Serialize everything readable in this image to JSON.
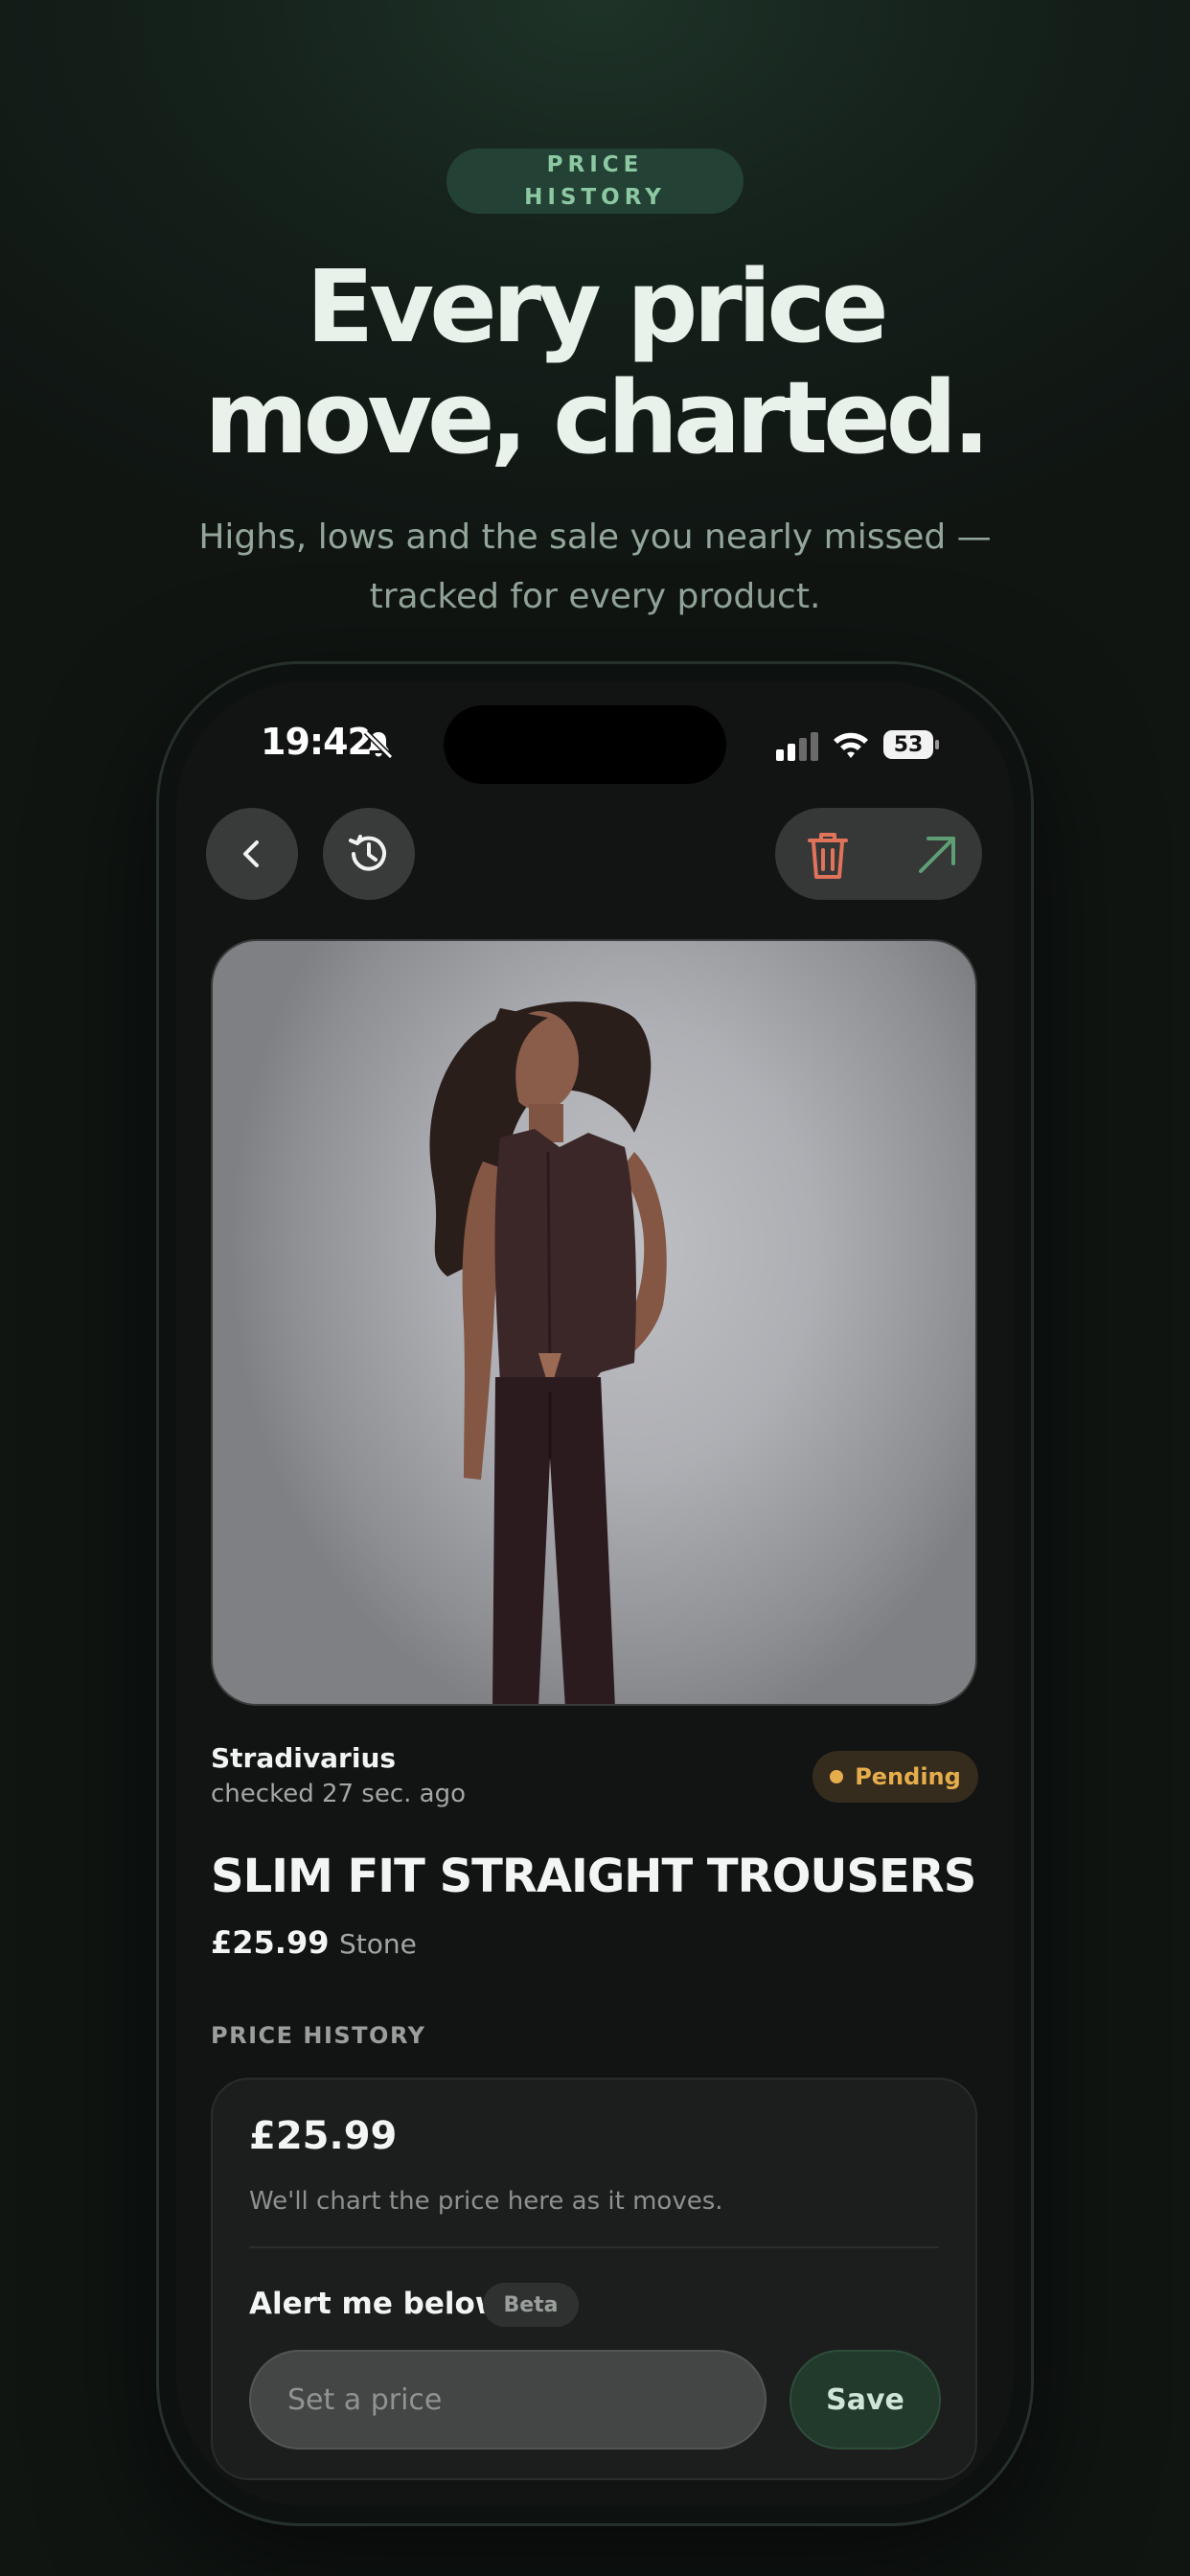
{
  "hero": {
    "eyebrow": "PRICE HISTORY",
    "headline_line1": "Every price",
    "headline_line2": "move, charted.",
    "subhead_line1": "Highs, lows and the sale you nearly missed —",
    "subhead_line2": "tracked for every product."
  },
  "status_bar": {
    "time": "19:42",
    "battery": "53",
    "icons": [
      "bell-slash-icon",
      "cellular-signal-icon",
      "wifi-icon",
      "battery-icon"
    ]
  },
  "toolbar": {
    "icons": [
      "chevron-left-icon",
      "history-icon",
      "trash-icon",
      "arrow-up-right-icon"
    ]
  },
  "product": {
    "brand": "Stradivarius",
    "checked": "checked 27 sec. ago",
    "status": "Pending",
    "title": "SLIM FIT STRAIGHT TROUSERS",
    "price": "£25.99",
    "color": "Stone"
  },
  "price_history": {
    "section_label": "PRICE HISTORY",
    "current_price": "£25.99",
    "note": "We'll chart the price here as it moves.",
    "alert_label": "Alert me below",
    "beta_label": "Beta",
    "input_placeholder": "Set a price",
    "save_label": "Save"
  },
  "colors": {
    "accent_green": "#8cc9a2",
    "trash_red": "#e0735a",
    "arrow_green": "#5f9e74",
    "pending_amber": "#e6ad4c"
  }
}
